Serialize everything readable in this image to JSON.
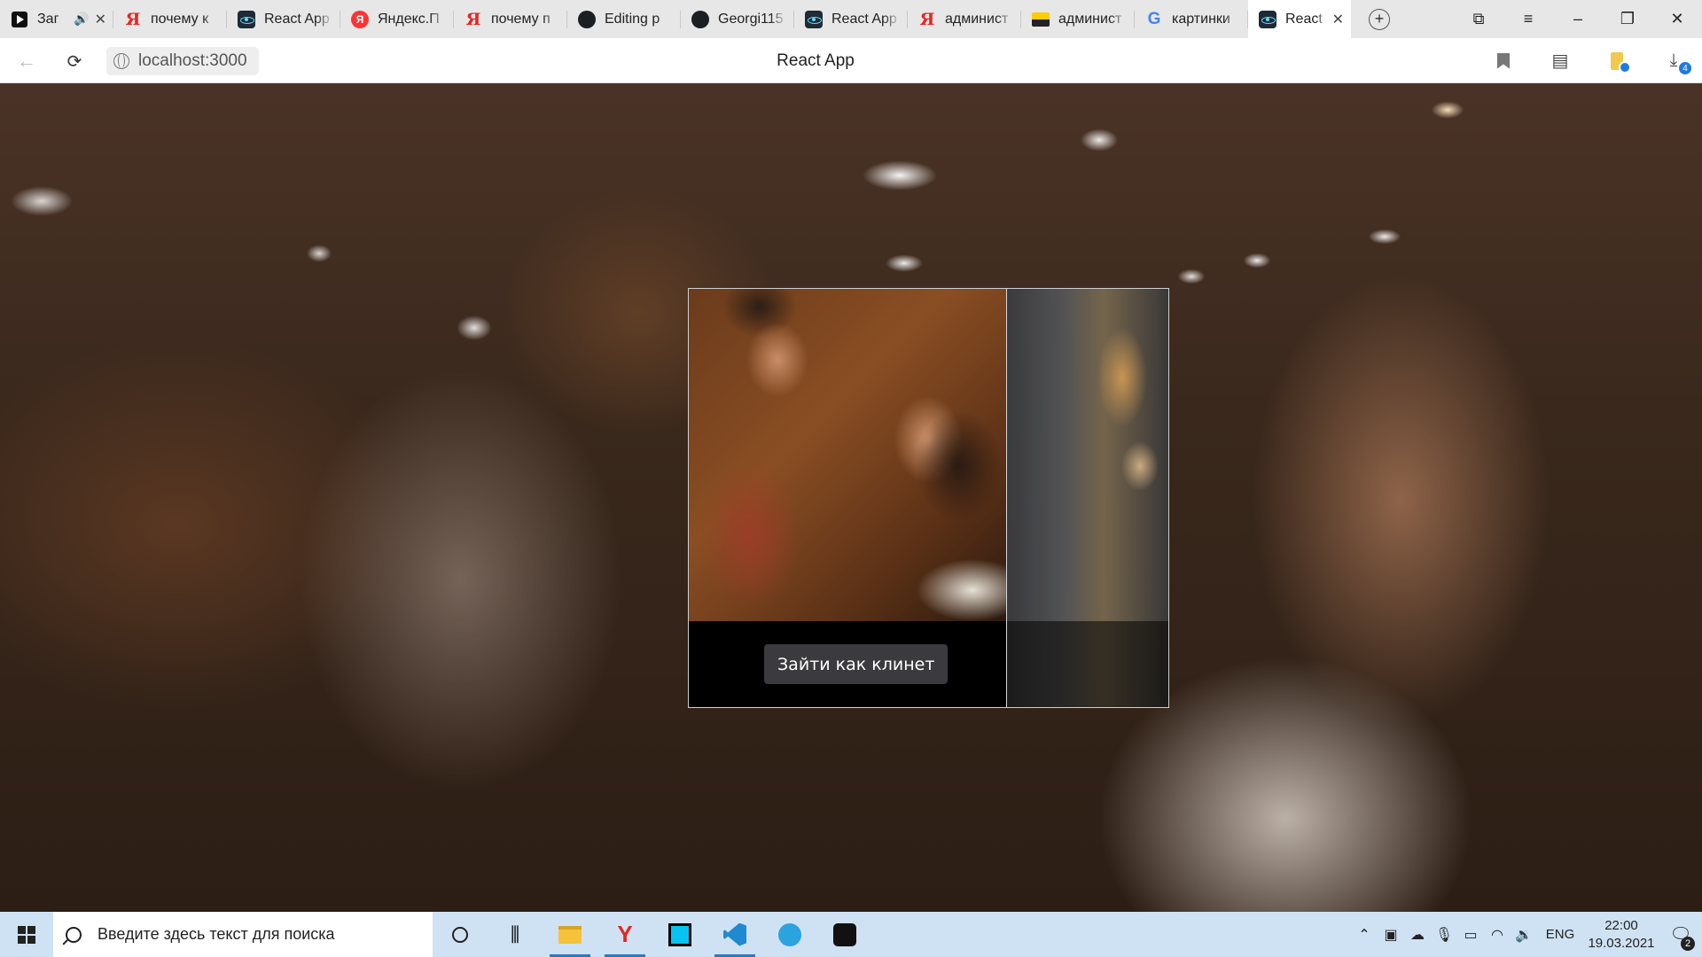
{
  "browser": {
    "tabs": [
      {
        "title": "Заг",
        "icon": "youtube-icon",
        "audio": true,
        "closable": true
      },
      {
        "title": "почему к",
        "icon": "yandex-y-icon"
      },
      {
        "title": "React App",
        "icon": "react-icon"
      },
      {
        "title": "Яндекс.П",
        "icon": "yandex-browser-icon"
      },
      {
        "title": "почему п",
        "icon": "yandex-y-icon"
      },
      {
        "title": "Editing p",
        "icon": "github-icon"
      },
      {
        "title": "Georgi115",
        "icon": "github-icon"
      },
      {
        "title": "React App",
        "icon": "react-icon"
      },
      {
        "title": "админист",
        "icon": "yandex-y-icon"
      },
      {
        "title": "админист",
        "icon": "image-icon"
      },
      {
        "title": "картинки",
        "icon": "google-icon"
      },
      {
        "title": "React A",
        "icon": "react-icon",
        "active": true,
        "closable": true
      }
    ],
    "address": "localhost:3000",
    "page_title": "React App",
    "downloads_badge": "4"
  },
  "app": {
    "login_button_label": "Зайти как клинет"
  },
  "taskbar": {
    "search_placeholder": "Введите здесь текст для поиска",
    "language": "ENG",
    "time": "22:00",
    "date": "19.03.2021",
    "notifications_count": "2"
  }
}
